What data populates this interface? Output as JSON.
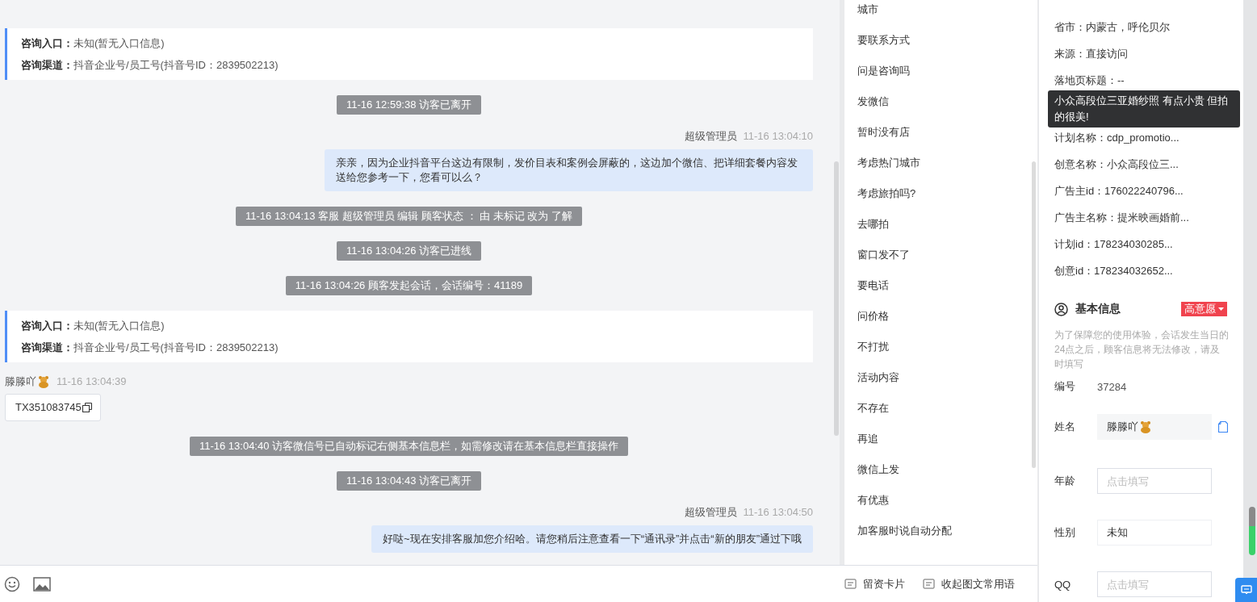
{
  "chat": {
    "messages": [
      {
        "kind": "entry",
        "lines": [
          {
            "label": "咨询入口：",
            "value": "未知(暂无入口信息)"
          },
          {
            "label": "咨询渠道：",
            "value": "抖音企业号/员工号(抖音号ID：2839502213)"
          }
        ]
      },
      {
        "kind": "system",
        "text": "11-16 12:59:38 访客已离开"
      },
      {
        "kind": "agent",
        "sender": "超级管理员",
        "time": "11-16 13:04:10",
        "text": "亲亲，因为企业抖音平台这边有限制，发价目表和案例会屏蔽的，这边加个微信、把详细套餐内容发送给您参考一下，您看可以么？"
      },
      {
        "kind": "system",
        "text": "11-16 13:04:13 客服 超级管理员 编辑 顾客状态 ： 由 未标记 改为 了解"
      },
      {
        "kind": "system",
        "text": "11-16 13:04:26 访客已进线"
      },
      {
        "kind": "system",
        "text": "11-16 13:04:26 顾客发起会话，会话编号：41189"
      },
      {
        "kind": "entry",
        "lines": [
          {
            "label": "咨询入口：",
            "value": "未知(暂无入口信息)"
          },
          {
            "label": "咨询渠道：",
            "value": "抖音企业号/员工号(抖音号ID：2839502213)"
          }
        ]
      },
      {
        "kind": "visitor",
        "sender": "滕滕吖",
        "time": "11-16 13:04:39",
        "text": "TX351083745"
      },
      {
        "kind": "system",
        "text": "11-16 13:04:40 访客微信号已自动标记右侧基本信息栏，如需修改请在基本信息栏直接操作"
      },
      {
        "kind": "system",
        "text": "11-16 13:04:43 访客已离开"
      },
      {
        "kind": "agent",
        "sender": "超级管理员",
        "time": "11-16 13:04:50",
        "text": "好哒~现在安排客服加您介绍哈。请您稍后注意查看一下“通讯录”并点击“新的朋友”通过下哦"
      }
    ]
  },
  "quick_phrases": {
    "items": [
      "城市",
      "要联系方式",
      "问是咨询吗",
      "发微信",
      "暂时没有店",
      "考虑热门城市",
      "考虑旅拍吗?",
      "去哪拍",
      "窗口发不了",
      "要电话",
      "问价格",
      "不打扰",
      "活动内容",
      "不存在",
      "再追",
      "微信上发",
      "有优惠",
      "加客服时说自动分配"
    ],
    "actions": [
      "留资卡片",
      "收起图文常用语"
    ]
  },
  "visitor_info": {
    "details": [
      "省市：内蒙古，呼伦贝尔",
      "来源：直接访问",
      "落地页标题：--"
    ],
    "tooltip": "小众高段位三亚婚纱照 有点小贵 但拍的很美!",
    "more_details": [
      "计划名称：cdp_promotio...",
      "创意名称：小众高段位三...",
      "广告主id：176022240796...",
      "广告主名称：提米映画婚前...",
      "计划id：178234030285...",
      "创意id：178234032652..."
    ],
    "basic": {
      "title": "基本信息",
      "intent": "高意愿",
      "notice": "为了保障您的使用体验，会话发生当日的24点之后，顾客信息将无法修改，请及时填写",
      "fields": [
        {
          "kind": "static",
          "label": "编号",
          "value": "37284"
        },
        {
          "kind": "readonly",
          "label": "姓名",
          "value": "滕滕吖"
        },
        {
          "kind": "input",
          "label": "年龄",
          "placeholder": "点击填写"
        },
        {
          "kind": "select",
          "label": "性别",
          "value": "未知"
        },
        {
          "kind": "input",
          "label": "QQ",
          "placeholder": "点击填写"
        }
      ]
    }
  }
}
